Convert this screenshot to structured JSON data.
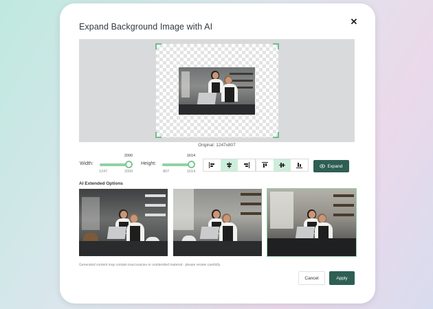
{
  "dialog": {
    "title": "Expand Background Image with AI",
    "close_icon": "close-icon"
  },
  "preview": {
    "original_label": "Original: 1247x807"
  },
  "controls": {
    "width_label": "Width:",
    "width_value": "2000",
    "width_min": "1247",
    "width_max": "2000",
    "width_fraction": 1.0,
    "height_label": "Height:",
    "height_value": "1614",
    "height_min": "807",
    "height_max": "1614",
    "height_fraction": 1.0,
    "horizontal_align": {
      "options": [
        "align-left-icon",
        "align-center-horizontal-icon",
        "align-right-icon"
      ],
      "selected": "align-center-horizontal-icon"
    },
    "vertical_align": {
      "options": [
        "align-top-icon",
        "align-middle-vertical-icon",
        "align-bottom-icon"
      ],
      "selected": "align-middle-vertical-icon"
    },
    "expand_label": "Expand",
    "expand_icon": "eye-icon"
  },
  "options": {
    "label": "AI Extended Options",
    "items": [
      "option-1",
      "option-2",
      "option-3"
    ],
    "selected_index": 2
  },
  "disclaimer": "Generated content may contain inaccuracies or unintended material - please review carefully.",
  "footer": {
    "cancel_label": "Cancel",
    "apply_label": "Apply"
  },
  "colors": {
    "primary": "#2e5e54",
    "accent": "#8fd1a8",
    "accent_light": "#cdeedb"
  }
}
